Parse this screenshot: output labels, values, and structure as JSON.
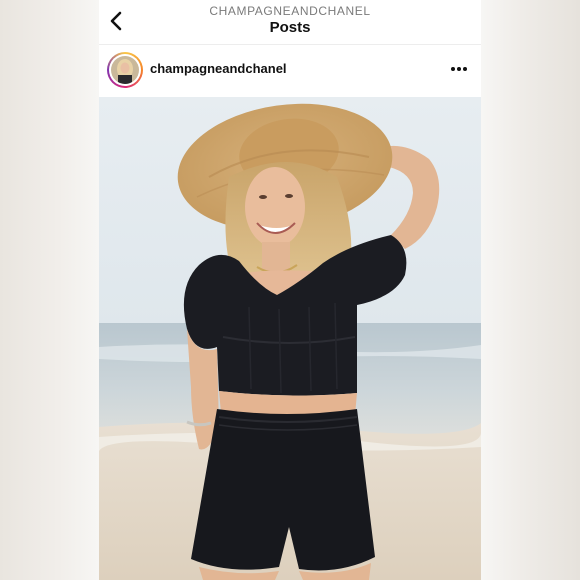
{
  "header": {
    "account_name": "CHAMPAGNEANDCHANEL",
    "title": "Posts",
    "back_icon": "chevron-left-icon"
  },
  "post": {
    "username": "champagneandchanel",
    "more_icon": "more-horizontal-icon",
    "avatar_ring_colors": [
      "#f9c84a",
      "#f58529",
      "#dd2a7b",
      "#8134af"
    ],
    "photo_subject": "woman in a straw sun hat and black two-piece outfit on a beach"
  },
  "colors": {
    "text_primary": "#111111",
    "text_secondary": "#7a7a7a",
    "divider": "#ededed"
  }
}
